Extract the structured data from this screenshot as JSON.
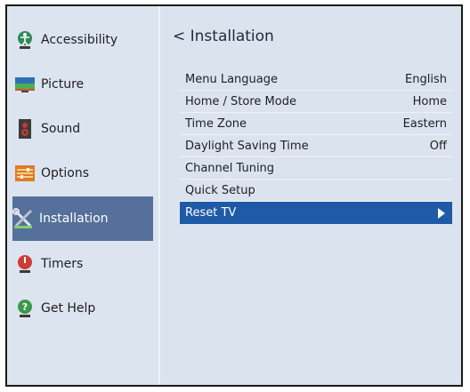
{
  "sidebar": {
    "items": [
      {
        "label": "Accessibility",
        "icon": "accessibility-icon"
      },
      {
        "label": "Picture",
        "icon": "picture-icon"
      },
      {
        "label": "Sound",
        "icon": "sound-icon"
      },
      {
        "label": "Options",
        "icon": "options-icon"
      },
      {
        "label": "Installation",
        "icon": "installation-icon",
        "selected": true
      },
      {
        "label": "Timers",
        "icon": "timers-icon"
      },
      {
        "label": "Get Help",
        "icon": "help-icon"
      }
    ]
  },
  "main": {
    "title": "< Installation",
    "rows": [
      {
        "label": "Menu Language",
        "value": "English"
      },
      {
        "label": "Home / Store Mode",
        "value": "Home"
      },
      {
        "label": "Time Zone",
        "value": "Eastern"
      },
      {
        "label": "Daylight Saving Time",
        "value": "Off"
      },
      {
        "label": "Channel Tuning",
        "value": ""
      },
      {
        "label": "Quick Setup",
        "value": ""
      },
      {
        "label": "Reset TV",
        "value": "",
        "selected": true
      }
    ]
  },
  "colors": {
    "panel": "#dbe3ef",
    "selected_side": "#55709a",
    "selected_row": "#1f5aa6"
  }
}
